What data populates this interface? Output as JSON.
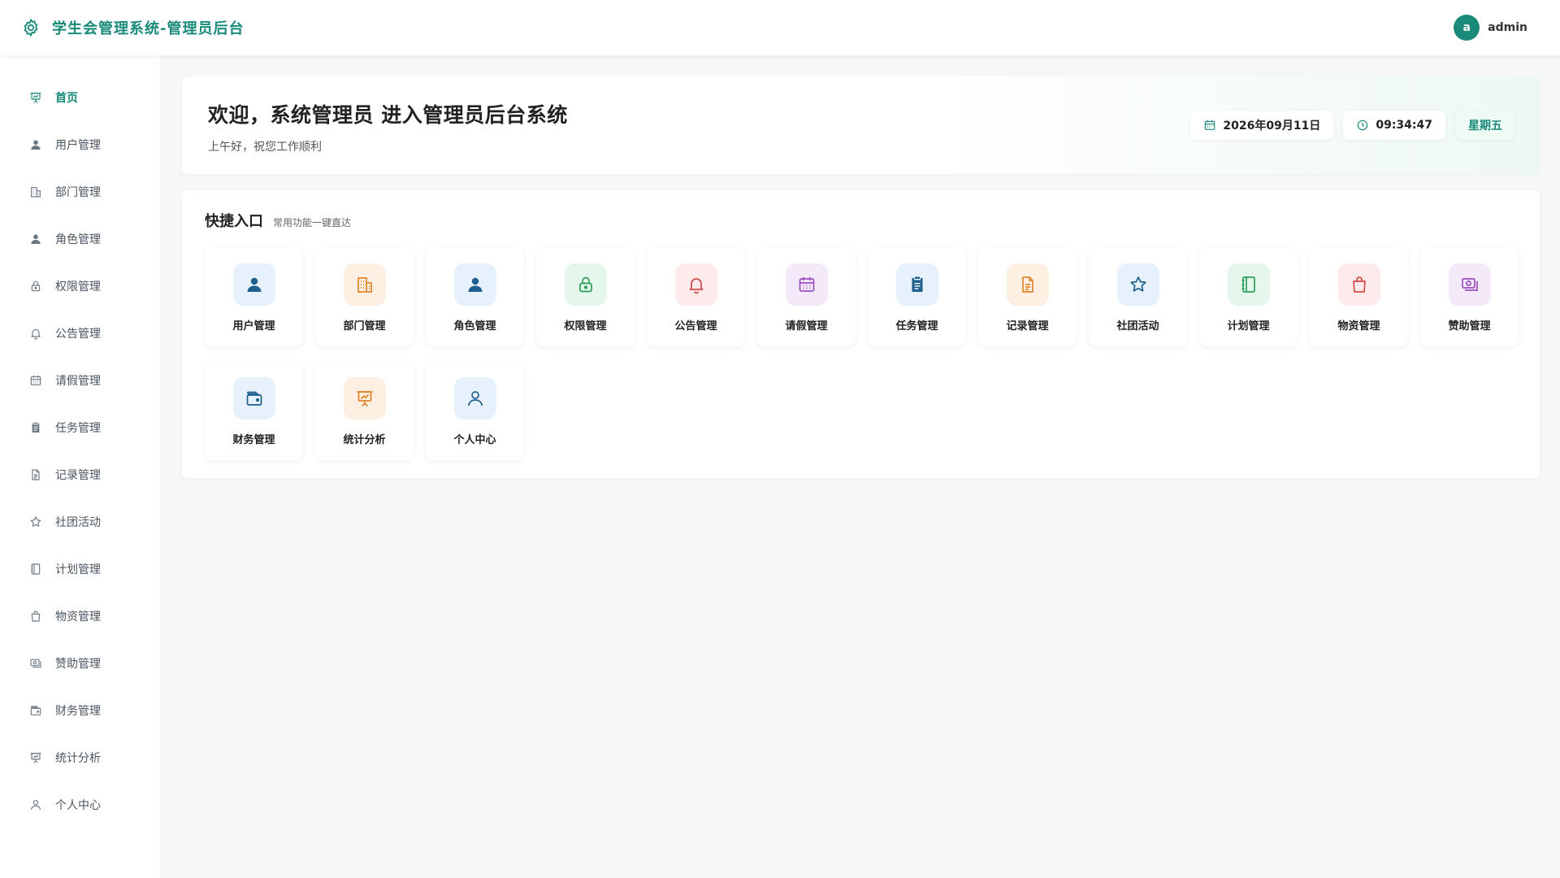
{
  "app": {
    "title": "学生会管理系统-管理员后台",
    "user": {
      "avatar_letter": "a",
      "name": "admin"
    }
  },
  "sidebar": {
    "items": [
      {
        "label": "首页",
        "icon": "presentation-chart-icon"
      },
      {
        "label": "用户管理",
        "icon": "user-icon"
      },
      {
        "label": "部门管理",
        "icon": "building-icon"
      },
      {
        "label": "角色管理",
        "icon": "user-icon"
      },
      {
        "label": "权限管理",
        "icon": "lock-icon"
      },
      {
        "label": "公告管理",
        "icon": "bell-icon"
      },
      {
        "label": "请假管理",
        "icon": "calendar-icon"
      },
      {
        "label": "任务管理",
        "icon": "clipboard-icon"
      },
      {
        "label": "记录管理",
        "icon": "document-icon"
      },
      {
        "label": "社团活动",
        "icon": "star-icon"
      },
      {
        "label": "计划管理",
        "icon": "notebook-icon"
      },
      {
        "label": "物资管理",
        "icon": "shopping-bag-icon"
      },
      {
        "label": "赞助管理",
        "icon": "money-icon"
      },
      {
        "label": "财务管理",
        "icon": "wallet-icon"
      },
      {
        "label": "统计分析",
        "icon": "presentation-chart-icon"
      },
      {
        "label": "个人中心",
        "icon": "user-outline-icon"
      }
    ],
    "active_index": 0
  },
  "welcome": {
    "title": "欢迎，系统管理员 进入管理员后台系统",
    "subtitle": "上午好，祝您工作顺利",
    "date": "2026年09月11日",
    "time": "09:34:47",
    "weekday": "星期五"
  },
  "quick": {
    "title": "快捷入口",
    "subtitle": "常用功能一键直达",
    "tiles": [
      {
        "label": "用户管理",
        "icon": "user-icon",
        "color": "blue"
      },
      {
        "label": "部门管理",
        "icon": "building-icon",
        "color": "orange"
      },
      {
        "label": "角色管理",
        "icon": "user-icon",
        "color": "blue"
      },
      {
        "label": "权限管理",
        "icon": "lock-icon",
        "color": "green"
      },
      {
        "label": "公告管理",
        "icon": "bell-icon",
        "color": "red"
      },
      {
        "label": "请假管理",
        "icon": "calendar-icon",
        "color": "purple"
      },
      {
        "label": "任务管理",
        "icon": "clipboard-icon",
        "color": "blue"
      },
      {
        "label": "记录管理",
        "icon": "document-icon",
        "color": "orange"
      },
      {
        "label": "社团活动",
        "icon": "star-icon",
        "color": "blue"
      },
      {
        "label": "计划管理",
        "icon": "notebook-icon",
        "color": "green"
      },
      {
        "label": "物资管理",
        "icon": "shopping-bag-icon",
        "color": "red"
      },
      {
        "label": "赞助管理",
        "icon": "money-icon",
        "color": "purple"
      },
      {
        "label": "财务管理",
        "icon": "wallet-icon",
        "color": "blue"
      },
      {
        "label": "统计分析",
        "icon": "presentation-chart-icon",
        "color": "orange"
      },
      {
        "label": "个人中心",
        "icon": "user-outline-icon",
        "color": "blue"
      }
    ]
  },
  "colors": {
    "accent": "#1a8a7a",
    "background": "#f5f7f9"
  }
}
